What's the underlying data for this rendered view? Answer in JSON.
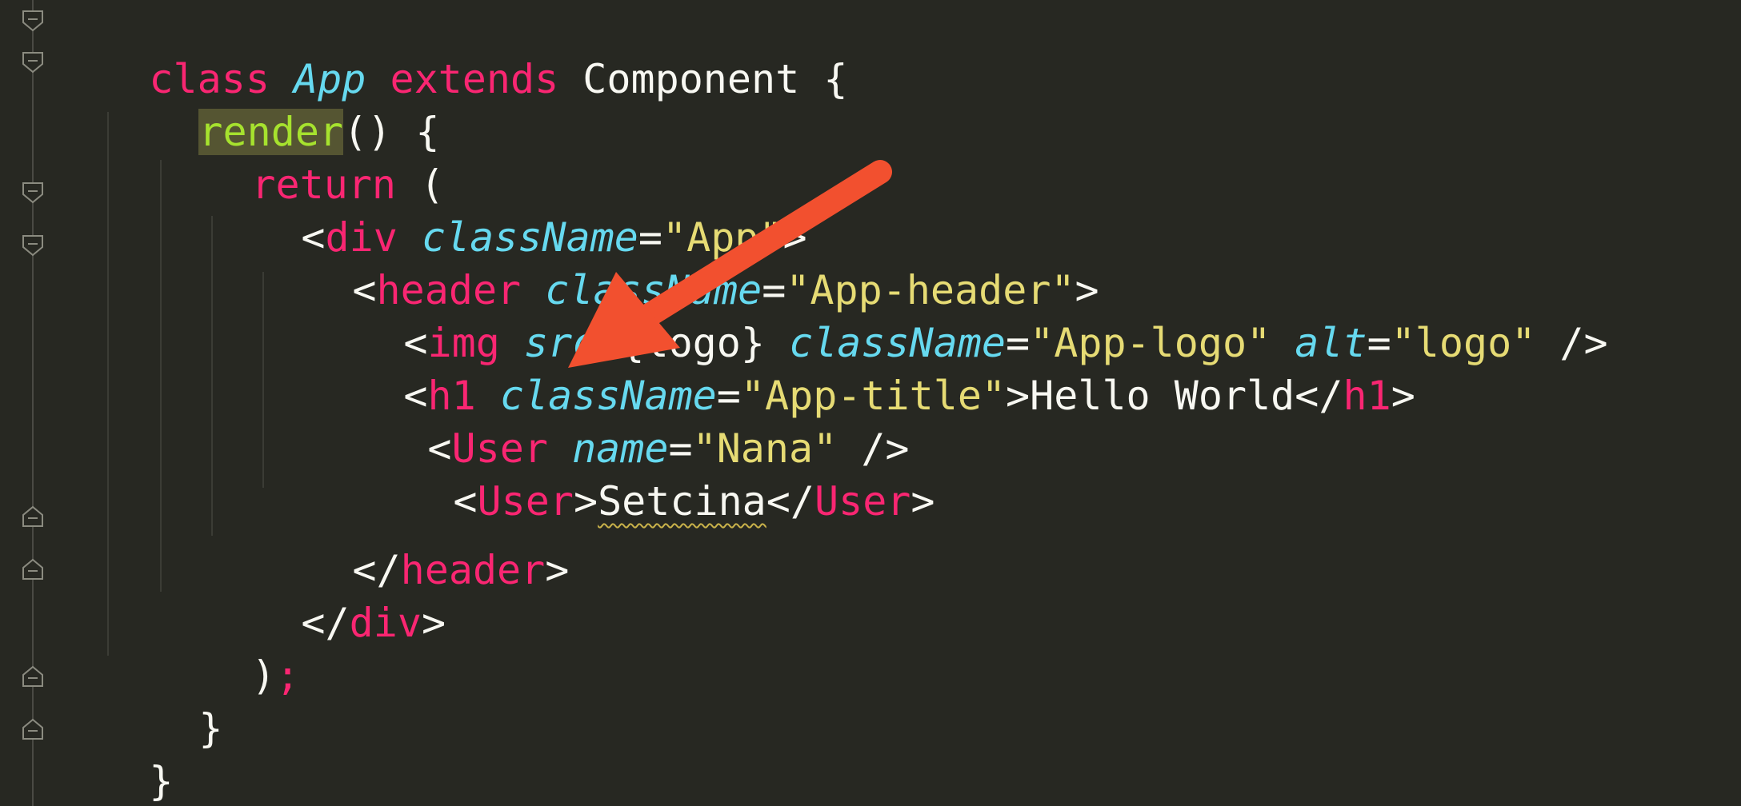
{
  "theme": {
    "background": "#272822",
    "keyword": "#f92672",
    "class_name": "#66d9ef",
    "string": "#e6db74",
    "function": "#a6e22e",
    "plain": "#f8f8f2",
    "annotation_arrow": "#f2502f"
  },
  "code": {
    "l1": {
      "t1": "class",
      "t2": " ",
      "t3": "App",
      "t4": " ",
      "t5": "extends",
      "t6": " Component {"
    },
    "l2": {
      "t1": "render",
      "t2": "() {"
    },
    "l3": {
      "t1": "return",
      "t2": " ("
    },
    "l4": {
      "t1": "<",
      "t2": "div",
      "t3": " ",
      "t4": "className",
      "t5": "=",
      "t6": "\"App\"",
      "t7": ">"
    },
    "l5": {
      "t1": "<",
      "t2": "header",
      "t3": " ",
      "t4": "className",
      "t5": "=",
      "t6": "\"App-header\"",
      "t7": ">"
    },
    "l6": {
      "t1": "<",
      "t2": "img",
      "t3": " ",
      "t4": "src",
      "t5": "={logo} ",
      "t6": "className",
      "t7": "=",
      "t8": "\"App-logo\"",
      "t9": " ",
      "t10": "alt",
      "t11": "=",
      "t12": "\"logo\"",
      "t13": " />"
    },
    "l7": {
      "t1": "<",
      "t2": "h1",
      "t3": " ",
      "t4": "className",
      "t5": "=",
      "t6": "\"App-title\"",
      "t7": ">Hello World</",
      "t8": "h1",
      "t9": ">"
    },
    "l8": {
      "t1": "<",
      "t2": "User",
      "t3": " ",
      "t4": "name",
      "t5": "=",
      "t6": "\"Nana\"",
      "t7": " />"
    },
    "l9": {
      "t1": "<",
      "t2": "User",
      "t3": ">",
      "t4": "Setcina",
      "t5": "</",
      "t6": "User",
      "t7": ">"
    },
    "l10": {
      "t1": "</",
      "t2": "header",
      "t3": ">"
    },
    "l11": {
      "t1": "</",
      "t2": "div",
      "t3": ">"
    },
    "l12": {
      "t1": ")",
      "t2": ";"
    },
    "l13": {
      "t1": "}"
    },
    "l14": {
      "t1": "}"
    }
  }
}
